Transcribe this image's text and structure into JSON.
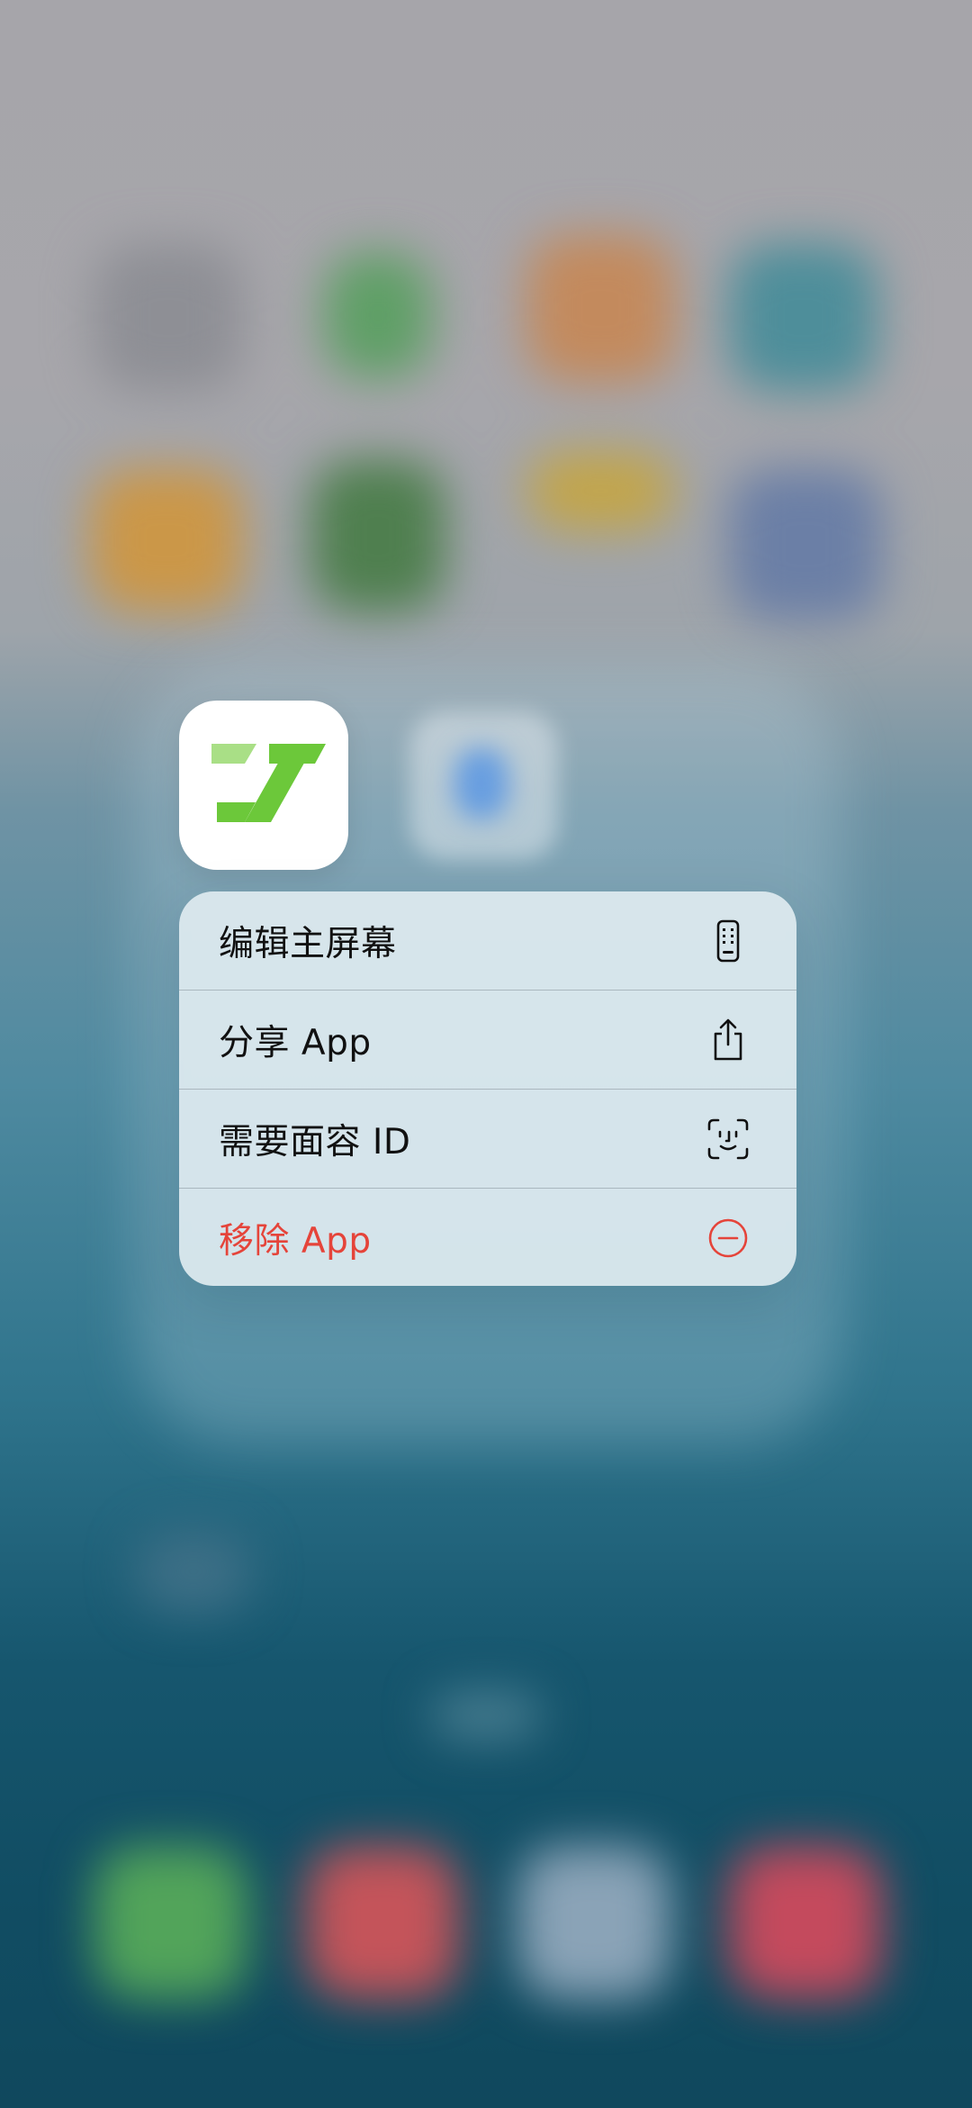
{
  "app": {
    "name": "green-z-app",
    "icon": "green-z-logo-icon"
  },
  "context_menu": {
    "items": [
      {
        "label": "编辑主屏幕",
        "icon": "phone-screen-icon",
        "color": "#111111"
      },
      {
        "label": "分享 App",
        "icon": "share-icon",
        "color": "#111111"
      },
      {
        "label": "需要面容 ID",
        "icon": "face-id-icon",
        "color": "#111111"
      },
      {
        "label": "移除 App",
        "icon": "minus-circle-icon",
        "color": "#e5443a"
      }
    ]
  },
  "colors": {
    "accent_green": "#6cc83a",
    "accent_green_light": "#a9df86",
    "destructive": "#e5443a"
  }
}
